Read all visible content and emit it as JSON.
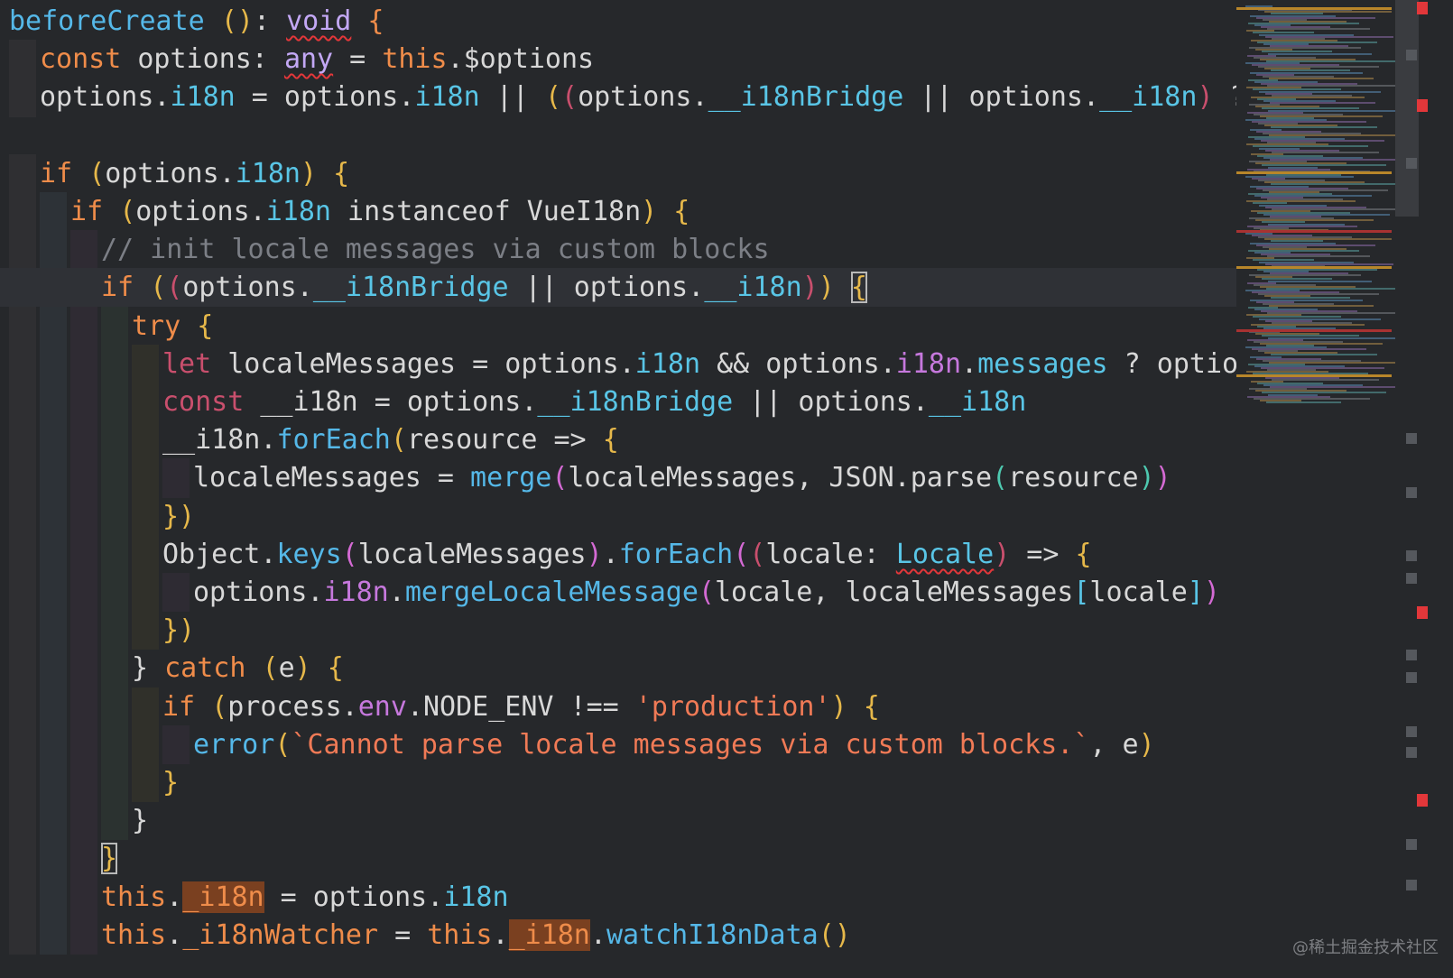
{
  "editor": {
    "lines": [
      {
        "indent": 0,
        "tokens": [
          {
            "t": "beforeCreate",
            "c": "fn"
          },
          {
            "t": " ",
            "c": "ident"
          },
          {
            "t": "()",
            "c": "brace"
          },
          {
            "t": ": ",
            "c": "ident"
          },
          {
            "t": "void",
            "c": "type",
            "s": 1
          },
          {
            "t": " ",
            "c": "ident"
          },
          {
            "t": "{",
            "c": "kw"
          }
        ]
      },
      {
        "indent": 1,
        "tokens": [
          {
            "t": "const",
            "c": "kw"
          },
          {
            "t": " options: ",
            "c": "ident"
          },
          {
            "t": "any",
            "c": "type",
            "s": 1
          },
          {
            "t": " = ",
            "c": "ident"
          },
          {
            "t": "this",
            "c": "kw"
          },
          {
            "t": ".$options",
            "c": "ident"
          }
        ]
      },
      {
        "indent": 1,
        "tokens": [
          {
            "t": "options.",
            "c": "ident"
          },
          {
            "t": "i18n",
            "c": "type2"
          },
          {
            "t": " = options.",
            "c": "ident"
          },
          {
            "t": "i18n",
            "c": "type2"
          },
          {
            "t": " || ",
            "c": "ident"
          },
          {
            "t": "(",
            "c": "brace"
          },
          {
            "t": "(",
            "c": "kw-ctrl"
          },
          {
            "t": "options.",
            "c": "ident"
          },
          {
            "t": "__i18nBridge",
            "c": "type2"
          },
          {
            "t": " || options.",
            "c": "ident"
          },
          {
            "t": "__i18n",
            "c": "type2"
          },
          {
            "t": ")",
            "c": "kw-ctrl"
          },
          {
            "t": " ? ",
            "c": "ident"
          },
          {
            "t": "{",
            "c": "brace"
          }
        ]
      },
      {
        "indent": 0,
        "tokens": []
      },
      {
        "indent": 1,
        "tokens": [
          {
            "t": "if",
            "c": "kw"
          },
          {
            "t": " ",
            "c": "ident"
          },
          {
            "t": "(",
            "c": "brace"
          },
          {
            "t": "options.",
            "c": "ident"
          },
          {
            "t": "i18n",
            "c": "type2"
          },
          {
            "t": ")",
            "c": "brace"
          },
          {
            "t": " ",
            "c": "ident"
          },
          {
            "t": "{",
            "c": "brace"
          }
        ]
      },
      {
        "indent": 2,
        "tokens": [
          {
            "t": "if",
            "c": "kw"
          },
          {
            "t": " ",
            "c": "ident"
          },
          {
            "t": "(",
            "c": "brace"
          },
          {
            "t": "options.",
            "c": "ident"
          },
          {
            "t": "i18n",
            "c": "type2"
          },
          {
            "t": " instanceof VueI18n",
            "c": "ident"
          },
          {
            "t": ")",
            "c": "brace"
          },
          {
            "t": " ",
            "c": "ident"
          },
          {
            "t": "{",
            "c": "brace"
          }
        ]
      },
      {
        "indent": 3,
        "tokens": [
          {
            "t": "// init locale messages via custom blocks",
            "c": "cmt"
          }
        ]
      },
      {
        "indent": 3,
        "current": true,
        "tokens": [
          {
            "t": "if",
            "c": "kw"
          },
          {
            "t": " ",
            "c": "ident"
          },
          {
            "t": "(",
            "c": "brace"
          },
          {
            "t": "(",
            "c": "kw-ctrl"
          },
          {
            "t": "options.",
            "c": "ident"
          },
          {
            "t": "__i18nBridge",
            "c": "type2"
          },
          {
            "t": " || options.",
            "c": "ident"
          },
          {
            "t": "__i18n",
            "c": "type2"
          },
          {
            "t": ")",
            "c": "kw-ctrl"
          },
          {
            "t": ")",
            "c": "brace"
          },
          {
            "t": " ",
            "c": "ident"
          },
          {
            "t": "{",
            "c": "brace",
            "box": 1
          }
        ]
      },
      {
        "indent": 4,
        "tokens": [
          {
            "t": "try",
            "c": "kw"
          },
          {
            "t": " ",
            "c": "ident"
          },
          {
            "t": "{",
            "c": "brace"
          }
        ]
      },
      {
        "indent": 5,
        "tokens": [
          {
            "t": "let",
            "c": "kw-ctrl"
          },
          {
            "t": " localeMessages = options.",
            "c": "ident"
          },
          {
            "t": "i18n",
            "c": "type2"
          },
          {
            "t": " && options.",
            "c": "ident"
          },
          {
            "t": "i18n",
            "c": "prop2"
          },
          {
            "t": ".",
            "c": "ident"
          },
          {
            "t": "messages",
            "c": "type2"
          },
          {
            "t": " ? options",
            "c": "ident"
          }
        ]
      },
      {
        "indent": 5,
        "tokens": [
          {
            "t": "const",
            "c": "kw-ctrl"
          },
          {
            "t": " __i18n = options.",
            "c": "ident"
          },
          {
            "t": "__i18nBridge",
            "c": "type2"
          },
          {
            "t": " || options.",
            "c": "ident"
          },
          {
            "t": "__i18n",
            "c": "type2"
          }
        ]
      },
      {
        "indent": 5,
        "tokens": [
          {
            "t": "__i18n.",
            "c": "ident"
          },
          {
            "t": "forEach",
            "c": "fn"
          },
          {
            "t": "(",
            "c": "brace"
          },
          {
            "t": "resource => ",
            "c": "ident"
          },
          {
            "t": "{",
            "c": "brace"
          }
        ]
      },
      {
        "indent": 6,
        "tokens": [
          {
            "t": "localeMessages = ",
            "c": "ident"
          },
          {
            "t": "merge",
            "c": "fn"
          },
          {
            "t": "(",
            "c": "brace2"
          },
          {
            "t": "localeMessages, JSON.",
            "c": "ident"
          },
          {
            "t": "parse",
            "c": "ident"
          },
          {
            "t": "(",
            "c": "brace3"
          },
          {
            "t": "resource",
            "c": "ident"
          },
          {
            "t": ")",
            "c": "brace3"
          },
          {
            "t": ")",
            "c": "brace2"
          }
        ]
      },
      {
        "indent": 5,
        "tokens": [
          {
            "t": "})",
            "c": "brace"
          }
        ]
      },
      {
        "indent": 5,
        "tokens": [
          {
            "t": "Object.",
            "c": "ident"
          },
          {
            "t": "keys",
            "c": "fn"
          },
          {
            "t": "(",
            "c": "brace2"
          },
          {
            "t": "localeMessages",
            "c": "ident"
          },
          {
            "t": ")",
            "c": "brace2"
          },
          {
            "t": ".",
            "c": "ident"
          },
          {
            "t": "forEach",
            "c": "fn"
          },
          {
            "t": "(",
            "c": "brace2"
          },
          {
            "t": "(",
            "c": "kw-ctrl"
          },
          {
            "t": "locale: ",
            "c": "ident"
          },
          {
            "t": "Locale",
            "c": "type2",
            "s": 1
          },
          {
            "t": ")",
            "c": "kw-ctrl"
          },
          {
            "t": " => ",
            "c": "ident"
          },
          {
            "t": "{",
            "c": "brace"
          }
        ]
      },
      {
        "indent": 6,
        "tokens": [
          {
            "t": "options.",
            "c": "ident"
          },
          {
            "t": "i18n",
            "c": "prop2"
          },
          {
            "t": ".",
            "c": "ident"
          },
          {
            "t": "mergeLocaleMessage",
            "c": "fn"
          },
          {
            "t": "(",
            "c": "brace2"
          },
          {
            "t": "locale, localeMessages",
            "c": "ident"
          },
          {
            "t": "[",
            "c": "type2"
          },
          {
            "t": "locale",
            "c": "ident"
          },
          {
            "t": "]",
            "c": "type2"
          },
          {
            "t": ")",
            "c": "brace2"
          }
        ]
      },
      {
        "indent": 5,
        "tokens": [
          {
            "t": "})",
            "c": "brace"
          }
        ]
      },
      {
        "indent": 4,
        "tokens": [
          {
            "t": "} ",
            "c": "ident"
          },
          {
            "t": "catch",
            "c": "kw"
          },
          {
            "t": " ",
            "c": "ident"
          },
          {
            "t": "(",
            "c": "brace"
          },
          {
            "t": "e",
            "c": "ident"
          },
          {
            "t": ")",
            "c": "brace"
          },
          {
            "t": " ",
            "c": "ident"
          },
          {
            "t": "{",
            "c": "brace"
          }
        ]
      },
      {
        "indent": 5,
        "tokens": [
          {
            "t": "if",
            "c": "kw"
          },
          {
            "t": " ",
            "c": "ident"
          },
          {
            "t": "(",
            "c": "brace"
          },
          {
            "t": "process.",
            "c": "ident"
          },
          {
            "t": "env",
            "c": "prop2"
          },
          {
            "t": ".NODE_ENV !== ",
            "c": "ident"
          },
          {
            "t": "'production'",
            "c": "str"
          },
          {
            "t": ")",
            "c": "brace"
          },
          {
            "t": " ",
            "c": "ident"
          },
          {
            "t": "{",
            "c": "brace"
          }
        ]
      },
      {
        "indent": 6,
        "tokens": [
          {
            "t": "error",
            "c": "fn"
          },
          {
            "t": "(",
            "c": "brace"
          },
          {
            "t": "`Cannot parse locale messages via custom blocks.`",
            "c": "str"
          },
          {
            "t": ", e",
            "c": "ident"
          },
          {
            "t": ")",
            "c": "brace"
          }
        ]
      },
      {
        "indent": 5,
        "tokens": [
          {
            "t": "}",
            "c": "brace"
          }
        ]
      },
      {
        "indent": 4,
        "tokens": [
          {
            "t": "}",
            "c": "ident"
          }
        ]
      },
      {
        "indent": 3,
        "tokens": [
          {
            "t": "}",
            "c": "brace",
            "box": 1
          }
        ]
      },
      {
        "indent": 3,
        "tokens": [
          {
            "t": "this",
            "c": "kw"
          },
          {
            "t": ".",
            "c": "ident"
          },
          {
            "t": "_i18n",
            "c": "kw",
            "hl": 1
          },
          {
            "t": " = options.",
            "c": "ident"
          },
          {
            "t": "i18n",
            "c": "type2"
          }
        ]
      },
      {
        "indent": 3,
        "tokens": [
          {
            "t": "this",
            "c": "kw"
          },
          {
            "t": ".",
            "c": "ident"
          },
          {
            "t": "_i18nWatcher",
            "c": "kw"
          },
          {
            "t": " = ",
            "c": "ident"
          },
          {
            "t": "this",
            "c": "kw"
          },
          {
            "t": ".",
            "c": "ident"
          },
          {
            "t": "_i18n",
            "c": "kw",
            "hl": 1
          },
          {
            "t": ".",
            "c": "ident"
          },
          {
            "t": "watchI18nData",
            "c": "fn"
          },
          {
            "t": "()",
            "c": "brace"
          }
        ]
      }
    ]
  },
  "watermark": "@稀土掘金技术社区",
  "colors": {
    "background": "#26282b",
    "current_line": "#2f3136",
    "scrollbar_error": "#e2373a",
    "minimap_highlight": "#b8862a"
  }
}
